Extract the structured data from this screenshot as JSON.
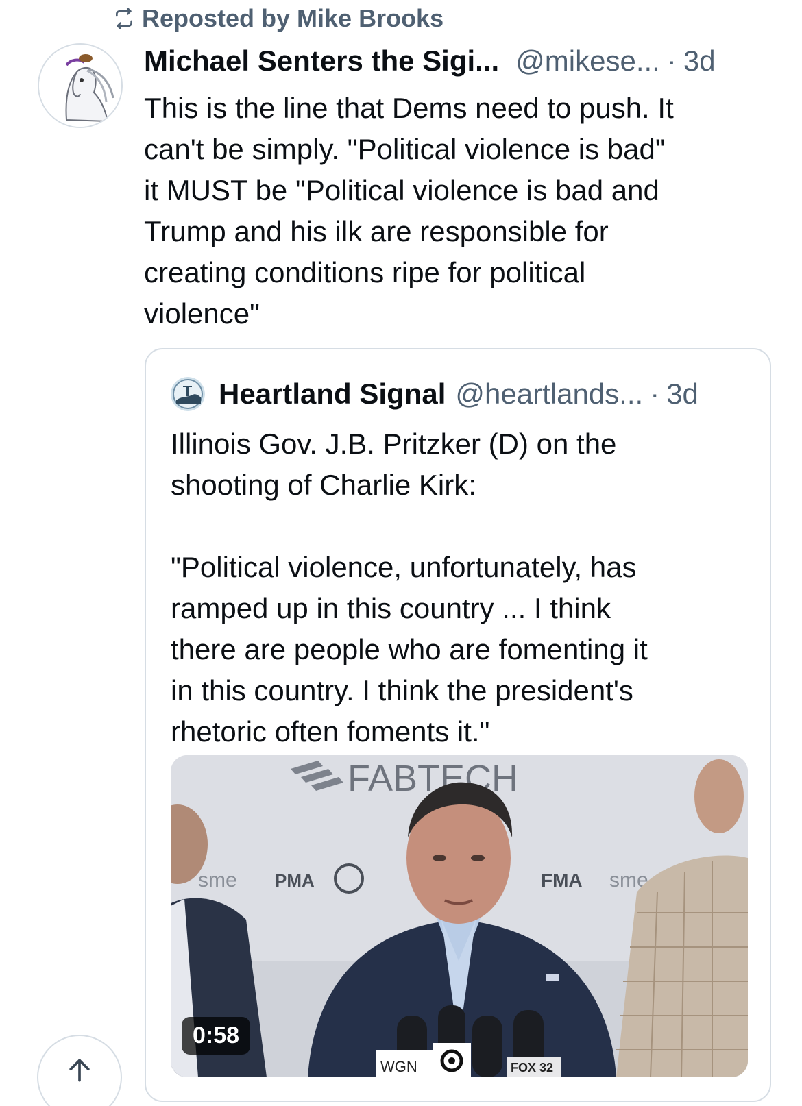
{
  "repost": {
    "icon": "repost-icon",
    "label": "Reposted by Mike Brooks"
  },
  "post": {
    "author_name": "Michael Senters the Sigi...",
    "author_handle": "@mikese...",
    "separator": "·",
    "time": "3d",
    "text": "This is the line that Dems need to push. It\ncan't be simply. \"Political violence is bad\"\nit MUST be \"Political violence is bad and\nTrump and his ilk are responsible for\ncreating conditions ripe for political\nviolence\""
  },
  "quote": {
    "author_name": "Heartland Signal",
    "author_handle": "@heartlands...",
    "separator": "·",
    "time": "3d",
    "text": "Illinois Gov. J.B. Pritzker (D) on the\nshooting of Charlie Kirk:\n\n\"Political violence, unfortunately, has\nramped up in this country ... I think\nthere are people who are fomenting it\nin this country. I think the president's\nrhetoric often foments it.\"",
    "video": {
      "duration": "0:58",
      "backdrop_text": "FABTECH",
      "backdrop_logos": [
        "sme",
        "PMA",
        "FMA",
        "sme"
      ],
      "mic_labels": [
        "WGN",
        "FOX 32"
      ]
    }
  },
  "scroll_top": {
    "icon": "arrow-up-icon"
  }
}
